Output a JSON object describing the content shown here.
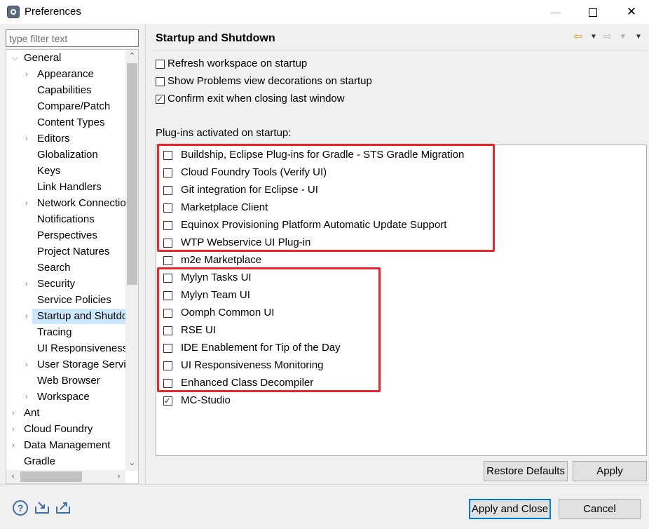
{
  "window": {
    "title": "Preferences",
    "minimize": "—",
    "close": "✕"
  },
  "sidebar": {
    "filter_placeholder": "type filter text",
    "items": [
      {
        "label": "General",
        "arrow": "⌵"
      },
      {
        "label": "Appearance",
        "arrow": "›"
      },
      {
        "label": "Capabilities",
        "arrow": ""
      },
      {
        "label": "Compare/Patch",
        "arrow": ""
      },
      {
        "label": "Content Types",
        "arrow": ""
      },
      {
        "label": "Editors",
        "arrow": "›"
      },
      {
        "label": "Globalization",
        "arrow": ""
      },
      {
        "label": "Keys",
        "arrow": ""
      },
      {
        "label": "Link Handlers",
        "arrow": ""
      },
      {
        "label": "Network Connectio",
        "arrow": "›"
      },
      {
        "label": "Notifications",
        "arrow": ""
      },
      {
        "label": "Perspectives",
        "arrow": ""
      },
      {
        "label": "Project Natures",
        "arrow": ""
      },
      {
        "label": "Search",
        "arrow": ""
      },
      {
        "label": "Security",
        "arrow": "›"
      },
      {
        "label": "Service Policies",
        "arrow": ""
      },
      {
        "label": "Startup and Shutdo",
        "arrow": "›"
      },
      {
        "label": "Tracing",
        "arrow": ""
      },
      {
        "label": "UI Responsiveness",
        "arrow": ""
      },
      {
        "label": "User Storage Servic",
        "arrow": "›"
      },
      {
        "label": "Web Browser",
        "arrow": ""
      },
      {
        "label": "Workspace",
        "arrow": "›"
      },
      {
        "label": "Ant",
        "arrow": "›"
      },
      {
        "label": "Cloud Foundry",
        "arrow": "›"
      },
      {
        "label": "Data Management",
        "arrow": "›"
      },
      {
        "label": "Gradle",
        "arrow": ""
      }
    ]
  },
  "main": {
    "title": "Startup and Shutdown",
    "options": [
      {
        "label": "Refresh workspace on startup",
        "checked": false
      },
      {
        "label": "Show Problems view decorations on startup",
        "checked": false
      },
      {
        "label": "Confirm exit when closing last window",
        "checked": true
      }
    ],
    "plugins_caption": "Plug-ins activated on startup:",
    "plugins": [
      {
        "label": "Buildship, Eclipse Plug-ins for Gradle - STS Gradle Migration",
        "checked": false
      },
      {
        "label": "Cloud Foundry Tools (Verify UI)",
        "checked": false
      },
      {
        "label": "Git integration for Eclipse - UI",
        "checked": false
      },
      {
        "label": "Marketplace Client",
        "checked": false
      },
      {
        "label": "Equinox Provisioning Platform Automatic Update Support",
        "checked": false
      },
      {
        "label": "WTP Webservice UI Plug-in",
        "checked": false
      },
      {
        "label": "m2e Marketplace",
        "checked": false
      },
      {
        "label": "Mylyn Tasks UI",
        "checked": false
      },
      {
        "label": "Mylyn Team UI",
        "checked": false
      },
      {
        "label": "Oomph Common UI",
        "checked": false
      },
      {
        "label": "RSE UI",
        "checked": false
      },
      {
        "label": "IDE Enablement for Tip of the Day",
        "checked": false
      },
      {
        "label": "UI Responsiveness Monitoring",
        "checked": false
      },
      {
        "label": "Enhanced Class Decompiler",
        "checked": false
      },
      {
        "label": "MC-Studio",
        "checked": true
      }
    ],
    "restore_defaults_label": "Restore Defaults",
    "apply_label": "Apply"
  },
  "footer": {
    "apply_close_label": "Apply and Close",
    "cancel_label": "Cancel"
  },
  "colors": {
    "highlight_border": "#e8262b",
    "selection": "#cce8ff",
    "default_button_border": "#0078d7"
  }
}
